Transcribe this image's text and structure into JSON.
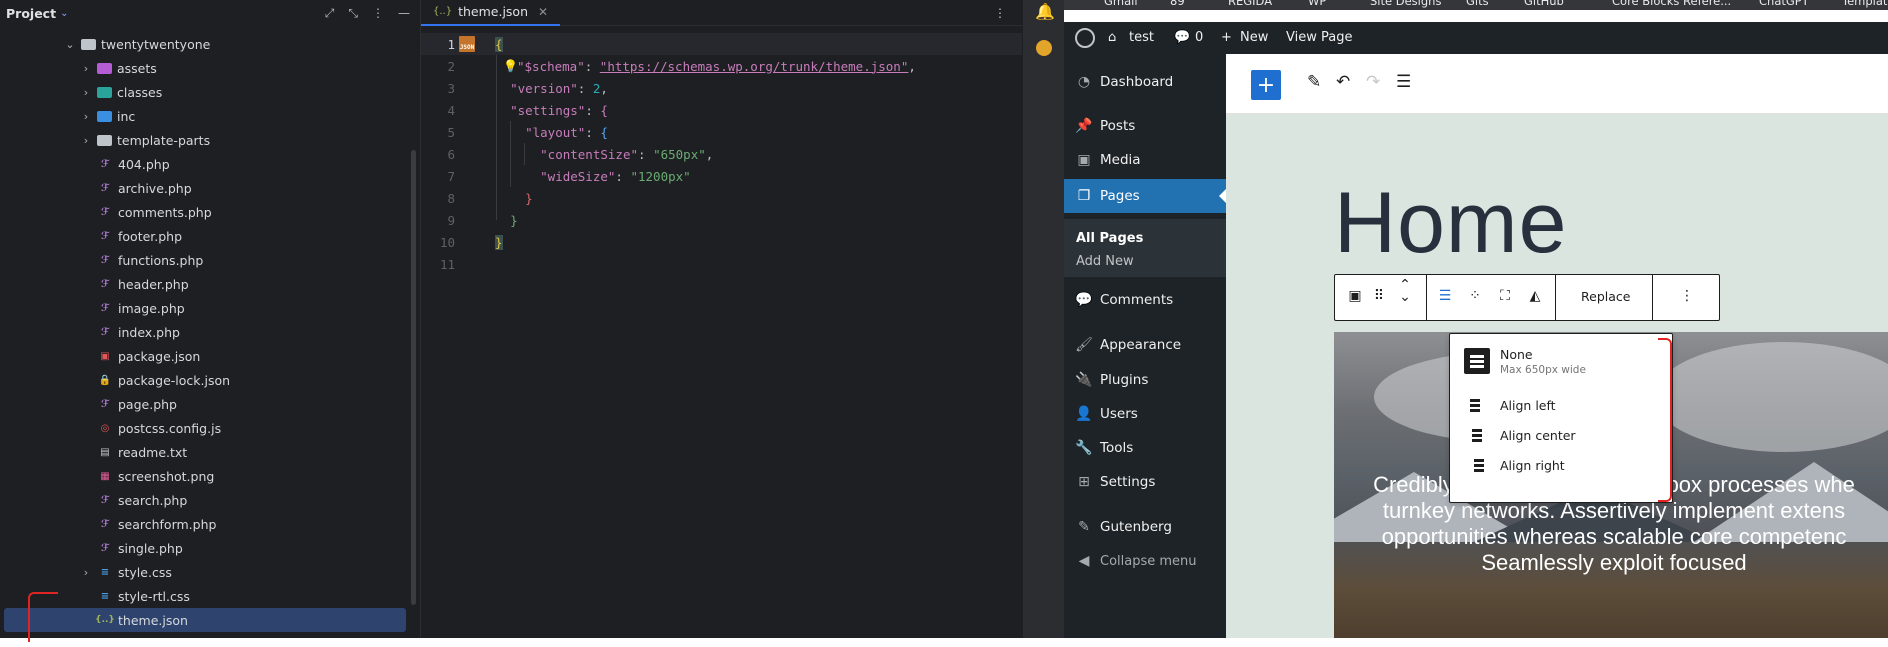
{
  "project": {
    "title": "Project",
    "items": [
      {
        "label": "twentytwentyone",
        "kind": "folder",
        "level": 0,
        "expanded": true
      },
      {
        "label": "assets",
        "kind": "folder-purple",
        "level": 1,
        "expanded": false
      },
      {
        "label": "classes",
        "kind": "folder-teal",
        "level": 1,
        "expanded": false
      },
      {
        "label": "inc",
        "kind": "folder-blue",
        "level": 1,
        "expanded": false
      },
      {
        "label": "template-parts",
        "kind": "folder",
        "level": 1,
        "expanded": false
      },
      {
        "label": "404.php",
        "kind": "php",
        "level": 1
      },
      {
        "label": "archive.php",
        "kind": "php",
        "level": 1
      },
      {
        "label": "comments.php",
        "kind": "php",
        "level": 1
      },
      {
        "label": "footer.php",
        "kind": "php",
        "level": 1
      },
      {
        "label": "functions.php",
        "kind": "php",
        "level": 1
      },
      {
        "label": "header.php",
        "kind": "php",
        "level": 1
      },
      {
        "label": "image.php",
        "kind": "php",
        "level": 1
      },
      {
        "label": "index.php",
        "kind": "php",
        "level": 1
      },
      {
        "label": "package.json",
        "kind": "npm",
        "level": 1
      },
      {
        "label": "package-lock.json",
        "kind": "lock",
        "level": 1
      },
      {
        "label": "page.php",
        "kind": "php",
        "level": 1
      },
      {
        "label": "postcss.config.js",
        "kind": "cfg",
        "level": 1
      },
      {
        "label": "readme.txt",
        "kind": "txt",
        "level": 1
      },
      {
        "label": "screenshot.png",
        "kind": "png",
        "level": 1
      },
      {
        "label": "search.php",
        "kind": "php",
        "level": 1
      },
      {
        "label": "searchform.php",
        "kind": "php",
        "level": 1
      },
      {
        "label": "single.php",
        "kind": "php",
        "level": 1
      },
      {
        "label": "style.css",
        "kind": "css",
        "level": 1,
        "expanded": false
      },
      {
        "label": "style-rtl.css",
        "kind": "css",
        "level": 1
      },
      {
        "label": "theme.json",
        "kind": "json",
        "level": 1,
        "selected": true
      }
    ]
  },
  "editor": {
    "tab_label": "theme.json",
    "line_numbers": [
      "1",
      "2",
      "3",
      "4",
      "5",
      "6",
      "7",
      "8",
      "9",
      "10",
      "11"
    ],
    "code": {
      "l2_key": "\"$schema\"",
      "l2_url": "\"https://schemas.wp.org/trunk/theme.json\"",
      "l3_key": "\"version\"",
      "l3_val": "2",
      "l4_key": "\"settings\"",
      "l5_key": "\"layout\"",
      "l6_key": "\"contentSize\"",
      "l6_val": "\"650px\"",
      "l7_key": "\"wideSize\"",
      "l7_val": "\"1200px\""
    }
  },
  "browser": {
    "bookmarks": [
      "Gmail",
      "89",
      "REGIDA",
      "WP",
      "Site Designs",
      "Gits",
      "GitHub",
      "Core Blocks Refere...",
      "ChatGPT",
      "Templat"
    ]
  },
  "adminbar": {
    "site": "test",
    "comments": "0",
    "new": "New",
    "view": "View Page"
  },
  "sidebar": {
    "items": [
      "Dashboard",
      "Posts",
      "Media",
      "Pages",
      "Comments",
      "Appearance",
      "Plugins",
      "Users",
      "Tools",
      "Settings",
      "Gutenberg",
      "Collapse menu"
    ],
    "sub": [
      "All Pages",
      "Add New"
    ]
  },
  "page": {
    "heading": "Home",
    "cover_lines": [
      "Credibly repurpose out-of-the-box processes whe",
      "turnkey networks. Assertively implement extens",
      "opportunities whereas scalable core competenc",
      "Seamlessly exploit focused"
    ]
  },
  "block_toolbar": {
    "replace": "Replace"
  },
  "align_menu": {
    "items": [
      {
        "label": "None",
        "sub": "Max 650px wide"
      },
      {
        "label": "Align left"
      },
      {
        "label": "Align center"
      },
      {
        "label": "Align right"
      }
    ]
  }
}
